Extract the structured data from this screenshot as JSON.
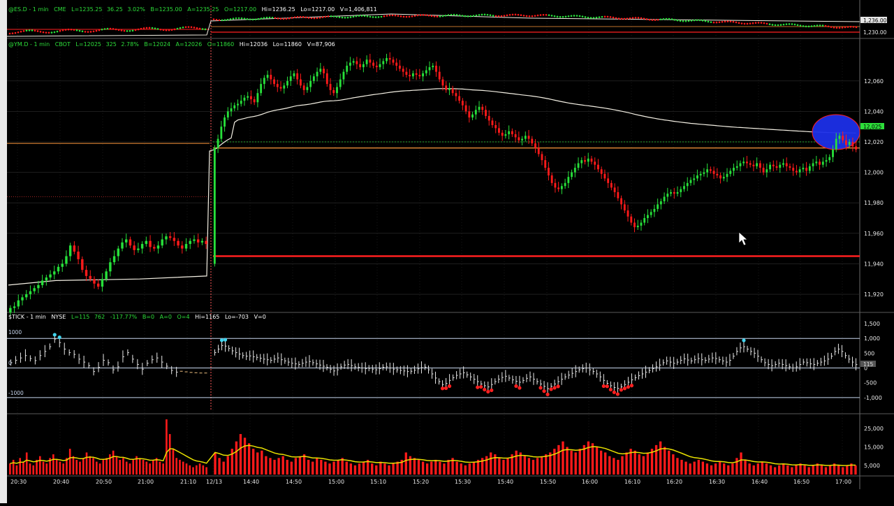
{
  "colors": {
    "up": "#27e03a",
    "down": "#ff1a1a",
    "background": "#000000",
    "grid": "#2f2f2f",
    "vwap": "#f4f0e4",
    "level_line": "#ff1f1f",
    "tick_line": "#c7d6ee",
    "tick_dot_high": "#42d4ee",
    "tick_dot_low": "#ff2020",
    "volume_avg": "#e8e000",
    "highlight_ellipse": "#1c2fe8",
    "header_green": "#2dde3a",
    "header_white": "#ffffff"
  },
  "es_panel": {
    "symbol": "@ES.D - 1 min",
    "exchange": "CME",
    "stats": {
      "last": "L=1235.25",
      "change": "36.25",
      "change_pct": "3.02%",
      "bid": "B=1235.00",
      "ask": "A=1235.25",
      "open": "O=1217.00",
      "high": "Hi=1236.25",
      "low": "Lo=1217.00",
      "volume": "V=1,406,811"
    },
    "axis_labels": [
      "1,236.00",
      "1,230.00"
    ]
  },
  "ym_panel": {
    "symbol": "@YM.D - 1 min",
    "exchange": "CBOT",
    "stats": {
      "last": "L=12025",
      "change": "325",
      "change_pct": "2.78%",
      "bid": "B=12024",
      "ask": "A=12026",
      "open": "O=11860",
      "high": "Hi=12036",
      "low": "Lo=11860",
      "volume": "V=87,906"
    },
    "price_tag": "12,025"
  },
  "tick_panel": {
    "symbol": "$TICK - 1 min",
    "exchange": "NYSE",
    "stats": {
      "last": "L=115",
      "change": "762",
      "change_pct": "-117.77%",
      "bid": "B=0",
      "ask": "A=0",
      "open": "O=4",
      "high": "Hi=1165",
      "low": "Lo=-703",
      "volume": "V=0"
    },
    "level_labels": [
      "1000",
      "0",
      "-1000"
    ],
    "value_tag": "115"
  },
  "chart_data": [
    {
      "type": "candlestick",
      "panel": "YM 1-minute price",
      "y_ticks": [
        11920,
        11940,
        11960,
        11980,
        12000,
        12020,
        12040,
        12060
      ],
      "y_tick_labels": [
        "11,920",
        "11,940",
        "11,960",
        "11,980",
        "12,000",
        "12,020",
        "12,040",
        "12,060"
      ],
      "ylim": [
        11909,
        12081
      ],
      "horizontal_levels": [
        {
          "name": "prior-low",
          "value": 11945,
          "color": "#ff1f1f"
        },
        {
          "name": "prior-open",
          "value": 12016,
          "color": "#ff9a3c"
        },
        {
          "name": "last-price",
          "value": 12020,
          "color": "#2dde3a"
        },
        {
          "name": "left-reference",
          "value": 12019,
          "color": "#ff9a3c"
        }
      ],
      "overnight_closes": [
        11911,
        11912,
        11916,
        11918,
        11920,
        11922,
        11924,
        11926,
        11929,
        11931,
        11933,
        11935,
        11938,
        11940,
        11945,
        11952,
        11948,
        11943,
        11936,
        11932,
        11930,
        11927,
        11925,
        11930,
        11935,
        11941,
        11945,
        11950,
        11954,
        11956,
        11952,
        11949,
        11950,
        11953,
        11955,
        11951,
        11950,
        11952,
        11956,
        11958,
        11957,
        11955,
        11952,
        11950,
        11953,
        11955,
        11956,
        11954,
        11955,
        11953
      ],
      "session_closes": [
        12016,
        12022,
        12030,
        12036,
        12040,
        12042,
        12044,
        12045,
        12047,
        12049,
        12050,
        12048,
        12046,
        12052,
        12058,
        12062,
        12064,
        12061,
        12058,
        12056,
        12055,
        12057,
        12060,
        12063,
        12065,
        12061,
        12057,
        12054,
        12056,
        12060,
        12063,
        12066,
        12068,
        12065,
        12058,
        12054,
        12052,
        12056,
        12061,
        12066,
        12070,
        12072,
        12073,
        12071,
        12069,
        12071,
        12074,
        12072,
        12070,
        12069,
        12071,
        12073,
        12075,
        12074,
        12072,
        12070,
        12068,
        12066,
        12064,
        12063,
        12065,
        12064,
        12063,
        12065,
        12067,
        12069,
        12070,
        12066,
        12061,
        12057,
        12054,
        12055,
        12052,
        12050,
        12047,
        12044,
        12040,
        12036,
        12038,
        12041,
        12043,
        12041,
        12037,
        12034,
        12031,
        12029,
        12026,
        12024,
        12025,
        12027,
        12025,
        12023,
        12021,
        12022,
        12024,
        12022,
        12019,
        12016,
        12012,
        12008,
        12003,
        11998,
        11993,
        11990,
        11989,
        11991,
        11993,
        11997,
        12000,
        12003,
        12006,
        12008,
        12007,
        12009,
        12007,
        12005,
        12002,
        11999,
        11996,
        11993,
        11990,
        11987,
        11983,
        11979,
        11975,
        11971,
        11967,
        11964,
        11965,
        11967,
        11970,
        11972,
        11974,
        11976,
        11979,
        11981,
        11984,
        11986,
        11987,
        11986,
        11987,
        11989,
        11991,
        11993,
        11995,
        11996,
        11998,
        11999,
        12000,
        12002,
        12001,
        11999,
        11998,
        11996,
        11997,
        11999,
        12001,
        12003,
        12004,
        12006,
        12007,
        12006,
        12005,
        12004,
        12006,
        12003,
        12000,
        12002,
        12005,
        12004,
        12003,
        12005,
        12006,
        12004,
        12003,
        12001,
        12000,
        12002,
        12003,
        12001,
        12004,
        12006,
        12007,
        12005,
        12007,
        12008,
        12010,
        12015,
        12022,
        12024,
        12021,
        12018,
        12020,
        12017,
        12015
      ]
    },
    {
      "type": "line",
      "panel": "$TICK 1-minute",
      "y_ticks": [
        1500,
        1000,
        500,
        0,
        -500,
        -1000
      ],
      "y_tick_labels": [
        "1,500",
        "1,000",
        "500",
        "0",
        "-500",
        "-1,000"
      ],
      "ylim": [
        -1500,
        1620
      ],
      "reference_levels": [
        1000,
        0,
        -1000
      ],
      "overnight_values": [
        180,
        260,
        340,
        420,
        320,
        250,
        420,
        560,
        720,
        980,
        860,
        640,
        520,
        460,
        300,
        200,
        80,
        -120,
        20,
        260,
        180,
        -60,
        40,
        380,
        520,
        300,
        120,
        -40,
        160,
        280,
        340,
        200,
        60,
        -80,
        -140,
        -110,
        -130,
        -150,
        -160,
        -170,
        -170
      ],
      "session_values": [
        520,
        640,
        760,
        740,
        660,
        580,
        520,
        470,
        420,
        400,
        410,
        380,
        360,
        330,
        300,
        280,
        260,
        300,
        340,
        280,
        240,
        200,
        160,
        140,
        120,
        160,
        200,
        220,
        180,
        140,
        100,
        60,
        20,
        -40,
        -100,
        -60,
        40,
        100,
        120,
        80,
        40,
        20,
        0,
        -20,
        -10,
        -40,
        -60,
        -20,
        20,
        40,
        0,
        -40,
        -60,
        -80,
        -100,
        -120,
        -110,
        -70,
        -30,
        10,
        30,
        -60,
        -200,
        -340,
        -460,
        -560,
        -520,
        -420,
        -330,
        -250,
        -200,
        -160,
        -230,
        -300,
        -380,
        -460,
        -540,
        -600,
        -640,
        -560,
        -460,
        -380,
        -320,
        -280,
        -340,
        -400,
        -450,
        -480,
        -420,
        -350,
        -300,
        -380,
        -460,
        -540,
        -620,
        -700,
        -620,
        -540,
        -460,
        -380,
        -300,
        -240,
        -180,
        -120,
        -60,
        -20,
        0,
        -60,
        -120,
        -200,
        -300,
        -420,
        -520,
        -600,
        -660,
        -690,
        -640,
        -560,
        -480,
        -400,
        -330,
        -260,
        -200,
        -140,
        -80,
        -20,
        40,
        100,
        180,
        240,
        200,
        160,
        200,
        260,
        310,
        270,
        240,
        280,
        320,
        280,
        260,
        300,
        340,
        320,
        280,
        240,
        200,
        260,
        400,
        560,
        680,
        720,
        640,
        560,
        500,
        400,
        280,
        180,
        120,
        80,
        120,
        160,
        120,
        80,
        40,
        0,
        40,
        120,
        200,
        180,
        140,
        120,
        160,
        200,
        240,
        300,
        400,
        560,
        640,
        560,
        420,
        300,
        200,
        115
      ]
    },
    {
      "type": "bar",
      "panel": "YM volume",
      "y_ticks": [
        25000,
        15000,
        5000
      ],
      "y_tick_labels": [
        "25,000",
        "15,000",
        "5,000"
      ],
      "ylim": [
        0,
        30000
      ],
      "overnight_volume": [
        6000,
        8000,
        5000,
        9000,
        7000,
        12000,
        6000,
        5000,
        8000,
        10000,
        7000,
        6000,
        9000,
        11000,
        8000,
        7000,
        6000,
        9000,
        14000,
        10000,
        8000,
        7000,
        9000,
        12000,
        10000,
        9000,
        7000,
        6000,
        8000,
        9000,
        11000,
        13000,
        10000,
        8000,
        9000,
        7000,
        6000,
        8000,
        10000,
        9000,
        8000,
        7000,
        6000,
        8000,
        9000,
        7000,
        6000,
        30000,
        22000,
        14000,
        9000,
        8000,
        7000,
        6000,
        5000,
        4000,
        5000,
        6000,
        5000,
        4000
      ],
      "session_volume": [
        12000,
        9000,
        7000,
        10000,
        14000,
        18000,
        22000,
        20000,
        17000,
        14000,
        12000,
        13000,
        10000,
        9000,
        8000,
        9000,
        10000,
        8000,
        7000,
        9000,
        10000,
        11000,
        8000,
        7000,
        9000,
        8000,
        7000,
        6000,
        7000,
        8000,
        9000,
        7000,
        6000,
        5000,
        6000,
        7000,
        8000,
        6000,
        5000,
        7000,
        6000,
        5000,
        6000,
        7000,
        8000,
        12000,
        10000,
        9000,
        8000,
        7000,
        6000,
        7000,
        8000,
        7000,
        6000,
        8000,
        9000,
        7000,
        6000,
        5000,
        6000,
        7000,
        8000,
        9000,
        10000,
        12000,
        11000,
        9000,
        8000,
        9000,
        11000,
        13000,
        12000,
        10000,
        9000,
        8000,
        9000,
        10000,
        11000,
        12000,
        14000,
        16000,
        18000,
        15000,
        13000,
        12000,
        14000,
        16000,
        18000,
        17000,
        15000,
        13000,
        12000,
        10000,
        9000,
        8000,
        10000,
        12000,
        14000,
        13000,
        11000,
        10000,
        12000,
        14000,
        16000,
        18000,
        15000,
        13000,
        11000,
        9000,
        8000,
        7000,
        6000,
        7000,
        8000,
        7000,
        6000,
        5000,
        6000,
        7000,
        6000,
        5000,
        6000,
        9000,
        12000,
        8000,
        6000,
        5000,
        6000,
        7000,
        6000,
        5000,
        4000,
        5000,
        6000,
        5000,
        4000,
        5000,
        6000,
        5000,
        4000,
        5000,
        6000,
        5000,
        4000,
        5000,
        6000,
        5000,
        4000,
        5000,
        6000,
        5000
      ]
    }
  ],
  "x_axis": {
    "labels": [
      "20:30",
      "20:40",
      "20:50",
      "21:00",
      "21:10",
      "12/13",
      "14:40",
      "14:50",
      "15:00",
      "15:10",
      "15:20",
      "15:30",
      "15:40",
      "15:50",
      "16:00",
      "16:10",
      "16:20",
      "16:30",
      "16:40",
      "16:50",
      "17:00"
    ]
  }
}
